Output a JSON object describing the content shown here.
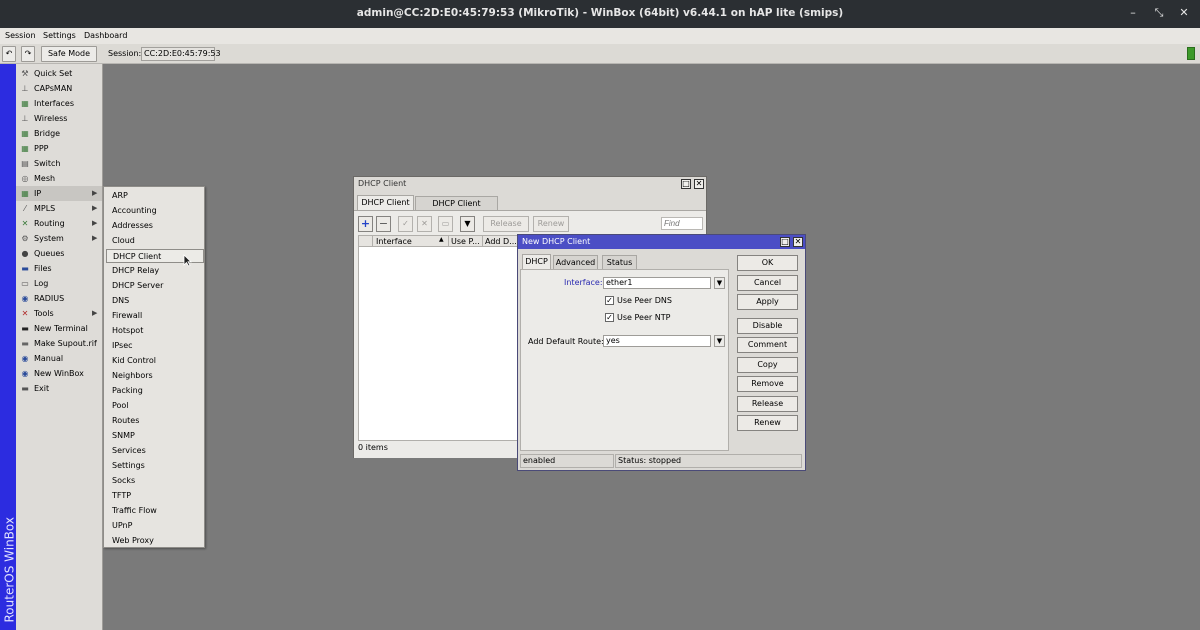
{
  "window": {
    "title": "admin@CC:2D:E0:45:79:53 (MikroTik) - WinBox (64bit) v6.44.1 on hAP lite (smips)",
    "minimize": "–",
    "restore": "⤡",
    "close": "✕"
  },
  "menu": {
    "session": "Session",
    "settings": "Settings",
    "dashboard": "Dashboard"
  },
  "toolbar": {
    "undo": "↶",
    "redo": "↷",
    "safe_mode": "Safe Mode",
    "session_label": "Session:",
    "session_value": "CC:2D:E0:45:79:53"
  },
  "brand": "RouterOS WinBox",
  "sidebar": {
    "items": [
      {
        "label": "Quick Set",
        "icon": "⚒"
      },
      {
        "label": "CAPsMAN",
        "icon": "⊥"
      },
      {
        "label": "Interfaces",
        "icon": "▦"
      },
      {
        "label": "Wireless",
        "icon": "⊥"
      },
      {
        "label": "Bridge",
        "icon": "▦"
      },
      {
        "label": "PPP",
        "icon": "▦"
      },
      {
        "label": "Switch",
        "icon": "▤"
      },
      {
        "label": "Mesh",
        "icon": "◎"
      },
      {
        "label": "IP",
        "icon": "▦"
      },
      {
        "label": "MPLS",
        "icon": "⁄"
      },
      {
        "label": "Routing",
        "icon": "✕"
      },
      {
        "label": "System",
        "icon": "⚙"
      },
      {
        "label": "Queues",
        "icon": "●"
      },
      {
        "label": "Files",
        "icon": "▬"
      },
      {
        "label": "Log",
        "icon": "▭"
      },
      {
        "label": "RADIUS",
        "icon": "◉"
      },
      {
        "label": "Tools",
        "icon": "✕"
      },
      {
        "label": "New Terminal",
        "icon": "▬"
      },
      {
        "label": "Make Supout.rif",
        "icon": "▬"
      },
      {
        "label": "Manual",
        "icon": "◉"
      },
      {
        "label": "New WinBox",
        "icon": "◉"
      },
      {
        "label": "Exit",
        "icon": "▬"
      }
    ]
  },
  "ip_submenu": {
    "items": [
      "ARP",
      "Accounting",
      "Addresses",
      "Cloud",
      "DHCP Client",
      "DHCP Relay",
      "DHCP Server",
      "DNS",
      "Firewall",
      "Hotspot",
      "IPsec",
      "Kid Control",
      "Neighbors",
      "Packing",
      "Pool",
      "Routes",
      "SNMP",
      "Services",
      "Settings",
      "Socks",
      "TFTP",
      "Traffic Flow",
      "UPnP",
      "Web Proxy"
    ]
  },
  "dhcp_client_window": {
    "title": "DHCP Client",
    "tabs": [
      "DHCP Client",
      "DHCP Client Options"
    ],
    "release": "Release",
    "renew": "Renew",
    "find_placeholder": "Find",
    "columns": [
      "Interface",
      "Use P...",
      "Add D..."
    ],
    "status": "0 items"
  },
  "new_dhcp_client": {
    "title": "New DHCP Client",
    "tabs": [
      "DHCP",
      "Advanced",
      "Status"
    ],
    "interface_label": "Interface:",
    "interface_value": "ether1",
    "use_peer_dns": "Use Peer DNS",
    "use_peer_ntp": "Use Peer NTP",
    "default_route_label": "Add Default Route:",
    "default_route_value": "yes",
    "buttons": [
      "OK",
      "Cancel",
      "Apply",
      "Disable",
      "Comment",
      "Copy",
      "Remove",
      "Release",
      "Renew"
    ],
    "status_left": "enabled",
    "status_right": "Status: stopped"
  }
}
